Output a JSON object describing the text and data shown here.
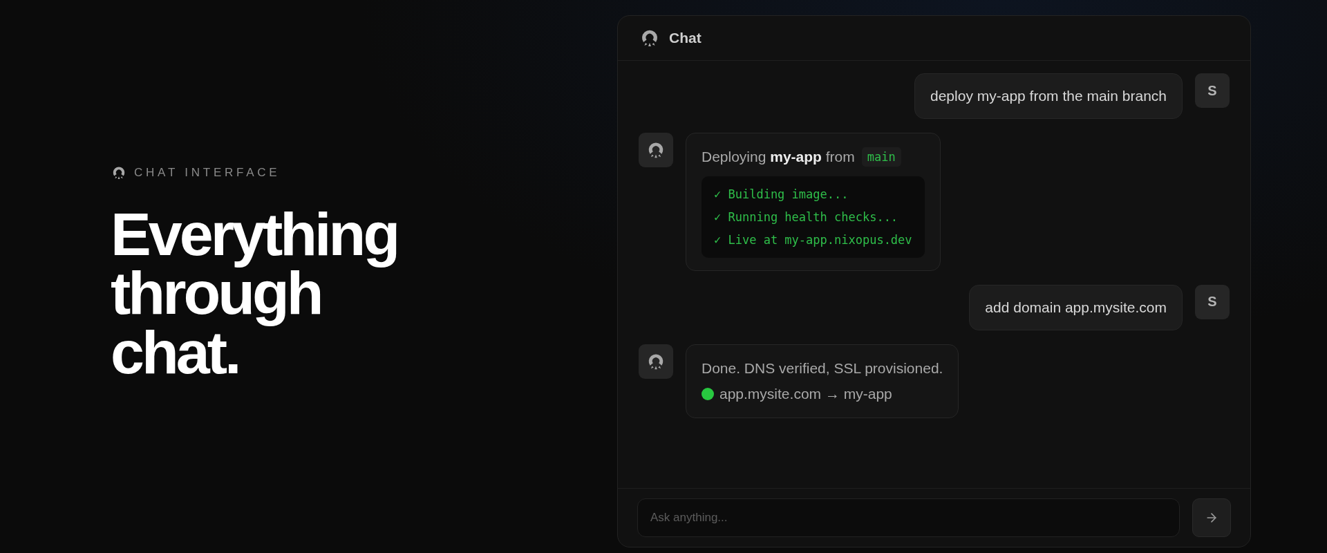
{
  "hero": {
    "eyebrow": "CHAT INTERFACE",
    "headline": "Everything through chat."
  },
  "chat": {
    "title": "Chat",
    "messages": [
      {
        "kind": "user",
        "avatar": "S",
        "text": "deploy my-app from the main branch"
      },
      {
        "kind": "deploy",
        "intro": "Deploying **my-app** from",
        "branch": "main",
        "steps": [
          "✓ Building image...",
          "✓ Running health checks...",
          "✓ Live at my-app.nixopus.dev"
        ]
      },
      {
        "kind": "user",
        "avatar": "S",
        "text": "add domain app.mysite.com"
      },
      {
        "kind": "status",
        "text": "Done. DNS verified, SSL provisioned.",
        "status": {
          "color": "#28c840",
          "text": "app.mysite.com → my-app"
        }
      }
    ],
    "input": {
      "placeholder": "Ask anything..."
    }
  }
}
